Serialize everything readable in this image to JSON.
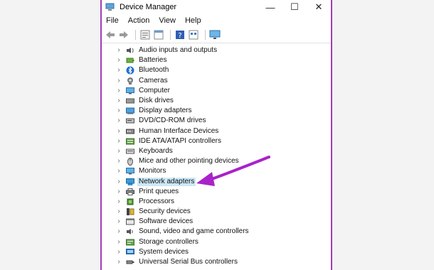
{
  "window": {
    "title": "Device Manager",
    "controls": {
      "minimize": "—",
      "maximize": "☐",
      "close": "✕"
    }
  },
  "menu": [
    "File",
    "Action",
    "View",
    "Help"
  ],
  "toolbar": [
    "back-icon",
    "forward-icon",
    "properties-icon",
    "console-icon",
    "help-icon",
    "view-icon",
    "monitor-icon"
  ],
  "devices": [
    {
      "label": "Audio inputs and outputs",
      "icon": "speaker-icon"
    },
    {
      "label": "Batteries",
      "icon": "battery-icon"
    },
    {
      "label": "Bluetooth",
      "icon": "bluetooth-icon"
    },
    {
      "label": "Cameras",
      "icon": "camera-icon"
    },
    {
      "label": "Computer",
      "icon": "computer-icon"
    },
    {
      "label": "Disk drives",
      "icon": "disk-icon"
    },
    {
      "label": "Display adapters",
      "icon": "display-adapter-icon"
    },
    {
      "label": "DVD/CD-ROM drives",
      "icon": "dvd-icon"
    },
    {
      "label": "Human Interface Devices",
      "icon": "hid-icon"
    },
    {
      "label": "IDE ATA/ATAPI controllers",
      "icon": "ide-icon"
    },
    {
      "label": "Keyboards",
      "icon": "keyboard-icon"
    },
    {
      "label": "Mice and other pointing devices",
      "icon": "mouse-icon"
    },
    {
      "label": "Monitors",
      "icon": "monitor-icon"
    },
    {
      "label": "Network adapters",
      "icon": "network-icon",
      "selected": true
    },
    {
      "label": "Print queues",
      "icon": "printer-icon"
    },
    {
      "label": "Processors",
      "icon": "processor-icon"
    },
    {
      "label": "Security devices",
      "icon": "security-icon"
    },
    {
      "label": "Software devices",
      "icon": "software-icon"
    },
    {
      "label": "Sound, video and game controllers",
      "icon": "sound-icon"
    },
    {
      "label": "Storage controllers",
      "icon": "storage-icon"
    },
    {
      "label": "System devices",
      "icon": "system-icon"
    },
    {
      "label": "Universal Serial Bus controllers",
      "icon": "usb-icon"
    }
  ],
  "colors": {
    "arrow": "#a823c9",
    "selection": "#cde8f7",
    "window_border": "#a23bb8"
  }
}
